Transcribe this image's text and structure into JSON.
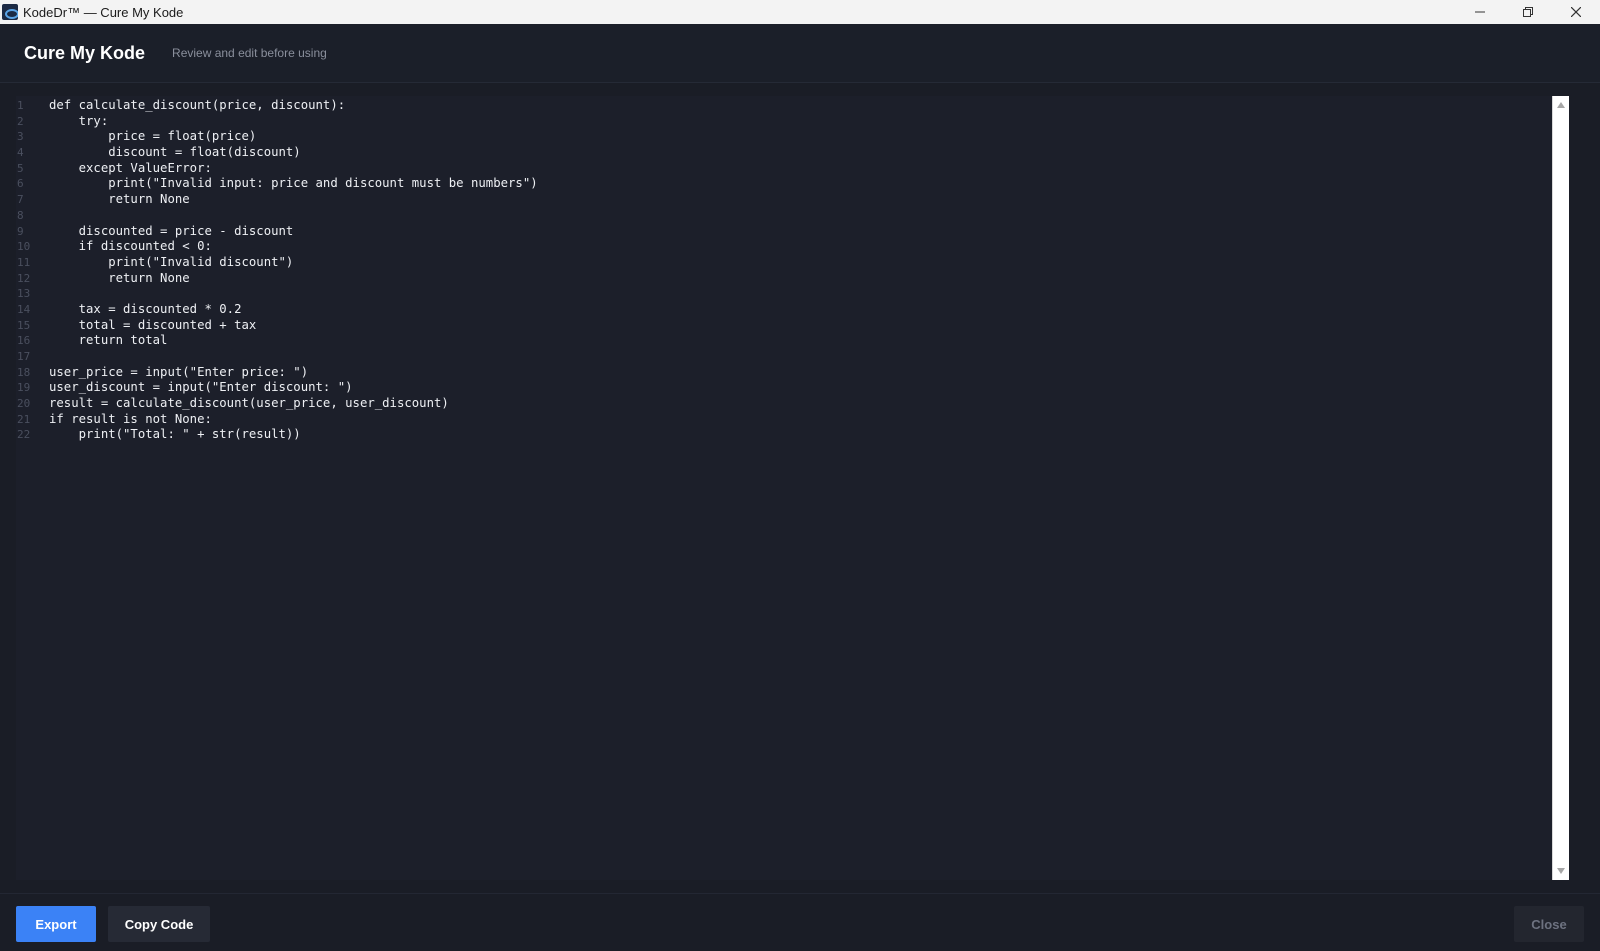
{
  "window": {
    "title": "KodeDr™ — Cure My Kode",
    "icons": {
      "app": "app-logo-icon",
      "minimize": "minimize-icon",
      "restore": "restore-icon",
      "close": "close-icon"
    }
  },
  "header": {
    "title": "Cure My Kode",
    "subtitle": "Review and edit before using"
  },
  "editor": {
    "lines": [
      {
        "num": "1",
        "code": "def calculate_discount(price, discount):"
      },
      {
        "num": "2",
        "code": "    try:"
      },
      {
        "num": "3",
        "code": "        price = float(price)"
      },
      {
        "num": "4",
        "code": "        discount = float(discount)"
      },
      {
        "num": "5",
        "code": "    except ValueError:"
      },
      {
        "num": "6",
        "code": "        print(\"Invalid input: price and discount must be numbers\")"
      },
      {
        "num": "7",
        "code": "        return None"
      },
      {
        "num": "8",
        "code": ""
      },
      {
        "num": "9",
        "code": "    discounted = price - discount"
      },
      {
        "num": "10",
        "code": "    if discounted < 0:"
      },
      {
        "num": "11",
        "code": "        print(\"Invalid discount\")"
      },
      {
        "num": "12",
        "code": "        return None"
      },
      {
        "num": "13",
        "code": ""
      },
      {
        "num": "14",
        "code": "    tax = discounted * 0.2"
      },
      {
        "num": "15",
        "code": "    total = discounted + tax"
      },
      {
        "num": "16",
        "code": "    return total"
      },
      {
        "num": "17",
        "code": ""
      },
      {
        "num": "18",
        "code": "user_price = input(\"Enter price: \")"
      },
      {
        "num": "19",
        "code": "user_discount = input(\"Enter discount: \")"
      },
      {
        "num": "20",
        "code": "result = calculate_discount(user_price, user_discount)"
      },
      {
        "num": "21",
        "code": "if result is not None:"
      },
      {
        "num": "22",
        "code": "    print(\"Total: \" + str(result))"
      }
    ]
  },
  "footer": {
    "export_label": "Export",
    "copy_label": "Copy Code",
    "close_label": "Close"
  },
  "colors": {
    "accent": "#3b82f6",
    "background": "#1a1d26",
    "editor_background": "#1c1f2a"
  }
}
